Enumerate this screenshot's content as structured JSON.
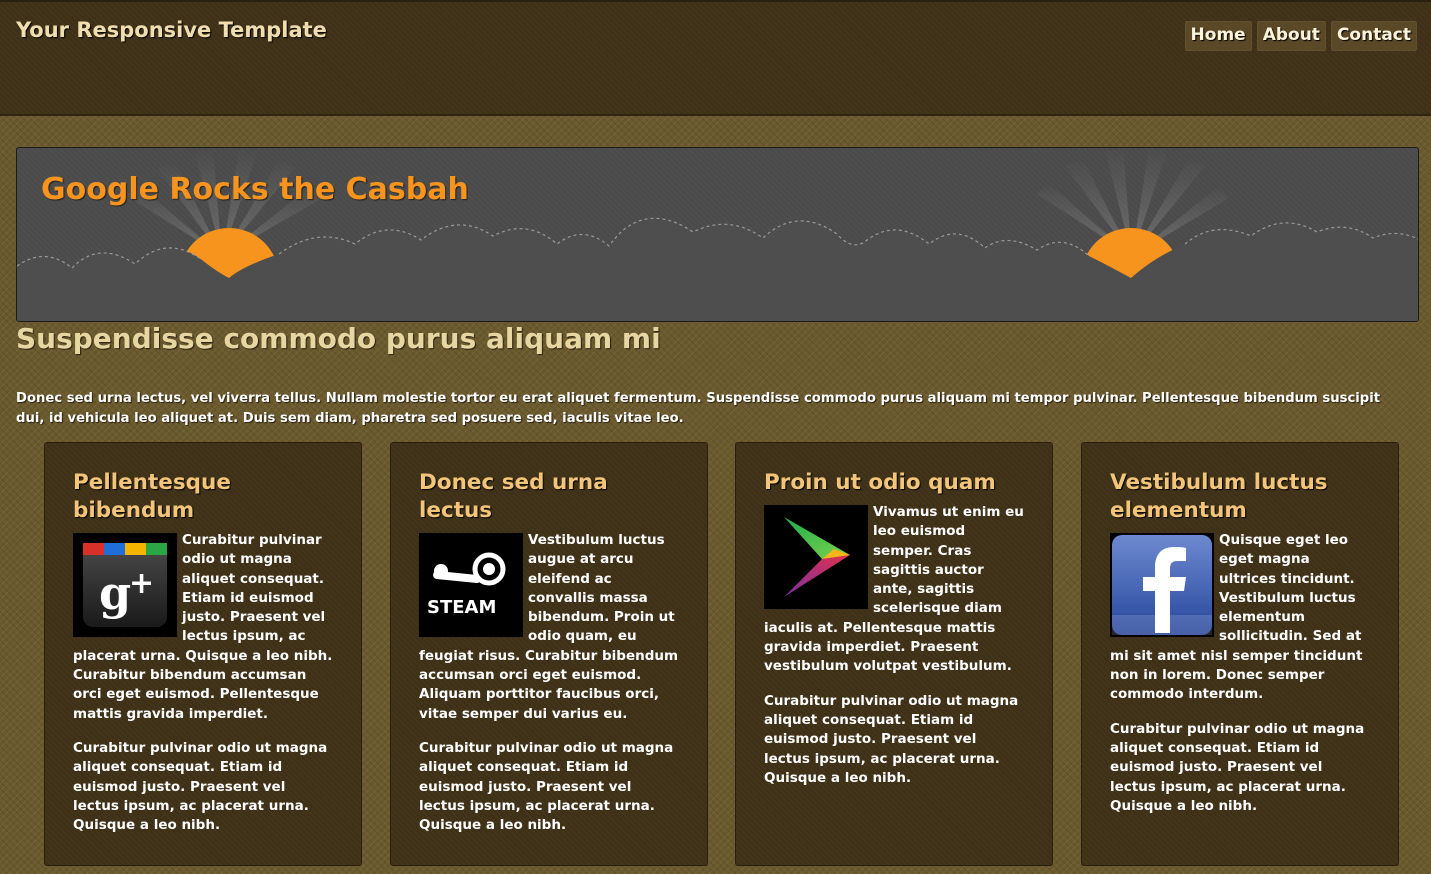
{
  "header": {
    "site_title": "Your Responsive Template",
    "nav": [
      {
        "label": "Home"
      },
      {
        "label": "About"
      },
      {
        "label": "Contact"
      }
    ]
  },
  "banner": {
    "title": "Google Rocks the Casbah"
  },
  "main": {
    "heading": "Suspendisse commodo purus aliquam mi",
    "intro": "Donec sed urna lectus, vel viverra tellus. Nullam molestie tortor eu erat aliquet fermentum. Suspendisse commodo purus aliquam mi tempor pulvinar. Pellentesque bibendum suscipit dui, id vehicula leo aliquet at. Duis sem diam, pharetra sed posuere sed, iaculis vitae leo."
  },
  "cards": [
    {
      "title": "Pellentesque bibendum",
      "icon": "google-plus-icon",
      "text": "Curabitur pulvinar odio ut magna aliquet consequat. Etiam id euismod justo. Praesent vel lectus ipsum, ac placerat urna. Quisque a leo nibh. Curabitur bibendum accumsan orci eget euismod. Pellentesque mattis gravida imperdiet.",
      "text2": "Curabitur pulvinar odio ut magna aliquet consequat. Etiam id euismod justo. Praesent vel lectus ipsum, ac placerat urna. Quisque a leo nibh."
    },
    {
      "title": "Donec sed urna lectus",
      "icon": "steam-icon",
      "icon_text": "STEAM",
      "text": "Vestibulum luctus augue at arcu eleifend ac convallis massa bibendum. Proin ut odio quam, eu feugiat risus. Curabitur bibendum accumsan orci eget euismod. Aliquam porttitor faucibus orci, vitae semper dui varius eu.",
      "text2": "Curabitur pulvinar odio ut magna aliquet consequat. Etiam id euismod justo. Praesent vel lectus ipsum, ac placerat urna. Quisque a leo nibh."
    },
    {
      "title": "Proin ut odio quam",
      "icon": "play-store-icon",
      "text": "Vivamus ut enim eu leo euismod semper. Cras sagittis auctor ante, sagittis scelerisque diam iaculis at. Pellentesque mattis gravida imperdiet. Praesent vestibulum volutpat vestibulum.",
      "text2": "Curabitur pulvinar odio ut magna aliquet consequat. Etiam id euismod justo. Praesent vel lectus ipsum, ac placerat urna. Quisque a leo nibh."
    },
    {
      "title": "Vestibulum luctus elementum",
      "icon": "facebook-icon",
      "text": "Quisque eget leo eget magna ultrices tincidunt. Vestibulum luctus elementum sollicitudin. Sed at mi sit amet nisl semper tincidunt non in lorem. Donec semper commodo interdum.",
      "text2": "Curabitur pulvinar odio ut magna aliquet consequat. Etiam id euismod justo. Praesent vel lectus ipsum, ac placerat urna. Quisque a leo nibh."
    }
  ],
  "colors": {
    "accent": "#f7941d",
    "heading": "#f3c57a",
    "header_bg": "#3f3117",
    "page_bg": "#6b5a2e"
  }
}
